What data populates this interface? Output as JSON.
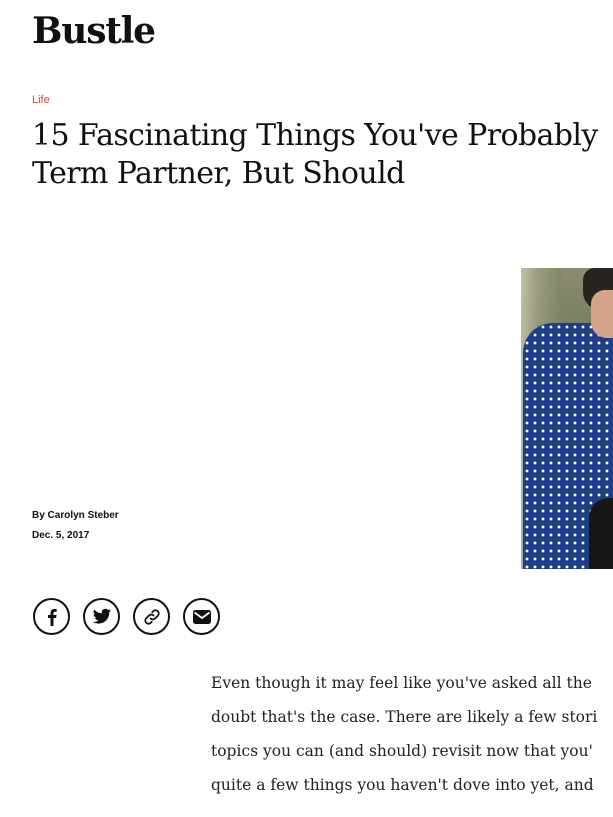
{
  "site": {
    "logo": "Bustle"
  },
  "article": {
    "category": "Life",
    "headline_line1": "15 Fascinating Things You've Probably",
    "headline_line2": "Term Partner, But Should",
    "byline": "By Carolyn Steber",
    "date": "Dec. 5, 2017",
    "body_lines": [
      "Even though it may feel like you've asked all the",
      "doubt that's the case. There are likely a few stori",
      "topics you can (and should) revisit now that you'",
      "quite a few things you haven't dove into yet, and"
    ]
  },
  "share": {
    "items": [
      {
        "icon": "facebook-icon"
      },
      {
        "icon": "twitter-icon"
      },
      {
        "icon": "link-icon"
      },
      {
        "icon": "email-icon"
      }
    ]
  }
}
